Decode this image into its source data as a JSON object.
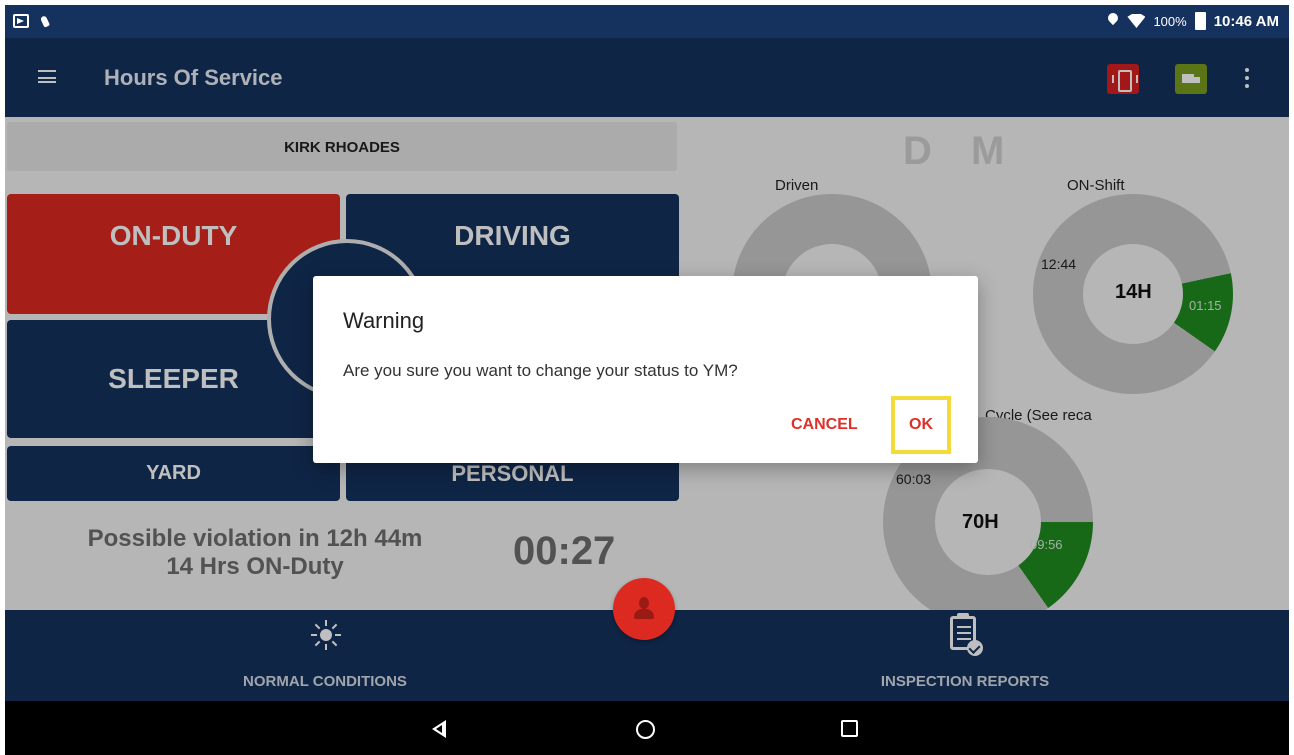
{
  "status_bar": {
    "battery_percent": "100%",
    "time": "10:46 AM",
    "icons": [
      "screen-record-icon",
      "touch-icon",
      "location-icon",
      "wifi-icon",
      "battery-icon"
    ]
  },
  "app_bar": {
    "title": "Hours Of Service",
    "icons": [
      "menu-icon",
      "phone-device-icon",
      "truck-icon",
      "more-vert-icon"
    ],
    "phone_icon_color": "#d81f1f",
    "truck_icon_color": "#7a9b1c"
  },
  "driver": {
    "name": "KIRK RHOADES"
  },
  "status_buttons": {
    "on_duty": "ON-DUTY",
    "driving": "DRIVING",
    "sleeper": "SLEEPER",
    "yard": "YARD",
    "personal": "PERSONAL"
  },
  "violation": {
    "line1": "Possible violation in 12h 44m",
    "line2": "14 Hrs ON-Duty",
    "timer": "00:27"
  },
  "gauges": {
    "header": "D M",
    "driven": {
      "label": "Driven"
    },
    "on_shift": {
      "label": "ON-Shift",
      "used": "12:44",
      "total": "14H",
      "remaining": "01:15"
    },
    "cycle": {
      "label": "Cycle (See reca",
      "used": "60:03",
      "total": "70H",
      "remaining": "09:56"
    }
  },
  "bottom_nav": {
    "normal_conditions": "NORMAL CONDITIONS",
    "inspection_reports": "INSPECTION REPORTS"
  },
  "dialog": {
    "title": "Warning",
    "message": "Are you sure you want to change your status to YM?",
    "cancel": "CANCEL",
    "ok": "OK"
  },
  "colors": {
    "primary": "#15325e",
    "on_duty": "#dd2a20",
    "gauge_green": "#1f8c21",
    "highlight": "#f3dc3a"
  }
}
